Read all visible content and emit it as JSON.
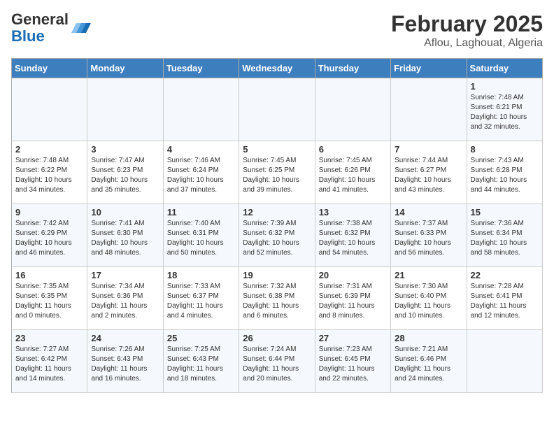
{
  "header": {
    "logo_general": "General",
    "logo_blue": "Blue",
    "title": "February 2025",
    "subtitle": "Aflou, Laghouat, Algeria"
  },
  "days_of_week": [
    "Sunday",
    "Monday",
    "Tuesday",
    "Wednesday",
    "Thursday",
    "Friday",
    "Saturday"
  ],
  "weeks": [
    [
      {
        "num": "",
        "info": ""
      },
      {
        "num": "",
        "info": ""
      },
      {
        "num": "",
        "info": ""
      },
      {
        "num": "",
        "info": ""
      },
      {
        "num": "",
        "info": ""
      },
      {
        "num": "",
        "info": ""
      },
      {
        "num": "1",
        "info": "Sunrise: 7:48 AM\nSunset: 6:21 PM\nDaylight: 10 hours and 32 minutes."
      }
    ],
    [
      {
        "num": "2",
        "info": "Sunrise: 7:48 AM\nSunset: 6:22 PM\nDaylight: 10 hours and 34 minutes."
      },
      {
        "num": "3",
        "info": "Sunrise: 7:47 AM\nSunset: 6:23 PM\nDaylight: 10 hours and 35 minutes."
      },
      {
        "num": "4",
        "info": "Sunrise: 7:46 AM\nSunset: 6:24 PM\nDaylight: 10 hours and 37 minutes."
      },
      {
        "num": "5",
        "info": "Sunrise: 7:45 AM\nSunset: 6:25 PM\nDaylight: 10 hours and 39 minutes."
      },
      {
        "num": "6",
        "info": "Sunrise: 7:45 AM\nSunset: 6:26 PM\nDaylight: 10 hours and 41 minutes."
      },
      {
        "num": "7",
        "info": "Sunrise: 7:44 AM\nSunset: 6:27 PM\nDaylight: 10 hours and 43 minutes."
      },
      {
        "num": "8",
        "info": "Sunrise: 7:43 AM\nSunset: 6:28 PM\nDaylight: 10 hours and 44 minutes."
      }
    ],
    [
      {
        "num": "9",
        "info": "Sunrise: 7:42 AM\nSunset: 6:29 PM\nDaylight: 10 hours and 46 minutes."
      },
      {
        "num": "10",
        "info": "Sunrise: 7:41 AM\nSunset: 6:30 PM\nDaylight: 10 hours and 48 minutes."
      },
      {
        "num": "11",
        "info": "Sunrise: 7:40 AM\nSunset: 6:31 PM\nDaylight: 10 hours and 50 minutes."
      },
      {
        "num": "12",
        "info": "Sunrise: 7:39 AM\nSunset: 6:32 PM\nDaylight: 10 hours and 52 minutes."
      },
      {
        "num": "13",
        "info": "Sunrise: 7:38 AM\nSunset: 6:32 PM\nDaylight: 10 hours and 54 minutes."
      },
      {
        "num": "14",
        "info": "Sunrise: 7:37 AM\nSunset: 6:33 PM\nDaylight: 10 hours and 56 minutes."
      },
      {
        "num": "15",
        "info": "Sunrise: 7:36 AM\nSunset: 6:34 PM\nDaylight: 10 hours and 58 minutes."
      }
    ],
    [
      {
        "num": "16",
        "info": "Sunrise: 7:35 AM\nSunset: 6:35 PM\nDaylight: 11 hours and 0 minutes."
      },
      {
        "num": "17",
        "info": "Sunrise: 7:34 AM\nSunset: 6:36 PM\nDaylight: 11 hours and 2 minutes."
      },
      {
        "num": "18",
        "info": "Sunrise: 7:33 AM\nSunset: 6:37 PM\nDaylight: 11 hours and 4 minutes."
      },
      {
        "num": "19",
        "info": "Sunrise: 7:32 AM\nSunset: 6:38 PM\nDaylight: 11 hours and 6 minutes."
      },
      {
        "num": "20",
        "info": "Sunrise: 7:31 AM\nSunset: 6:39 PM\nDaylight: 11 hours and 8 minutes."
      },
      {
        "num": "21",
        "info": "Sunrise: 7:30 AM\nSunset: 6:40 PM\nDaylight: 11 hours and 10 minutes."
      },
      {
        "num": "22",
        "info": "Sunrise: 7:28 AM\nSunset: 6:41 PM\nDaylight: 11 hours and 12 minutes."
      }
    ],
    [
      {
        "num": "23",
        "info": "Sunrise: 7:27 AM\nSunset: 6:42 PM\nDaylight: 11 hours and 14 minutes."
      },
      {
        "num": "24",
        "info": "Sunrise: 7:26 AM\nSunset: 6:43 PM\nDaylight: 11 hours and 16 minutes."
      },
      {
        "num": "25",
        "info": "Sunrise: 7:25 AM\nSunset: 6:43 PM\nDaylight: 11 hours and 18 minutes."
      },
      {
        "num": "26",
        "info": "Sunrise: 7:24 AM\nSunset: 6:44 PM\nDaylight: 11 hours and 20 minutes."
      },
      {
        "num": "27",
        "info": "Sunrise: 7:23 AM\nSunset: 6:45 PM\nDaylight: 11 hours and 22 minutes."
      },
      {
        "num": "28",
        "info": "Sunrise: 7:21 AM\nSunset: 6:46 PM\nDaylight: 11 hours and 24 minutes."
      },
      {
        "num": "",
        "info": ""
      }
    ]
  ]
}
